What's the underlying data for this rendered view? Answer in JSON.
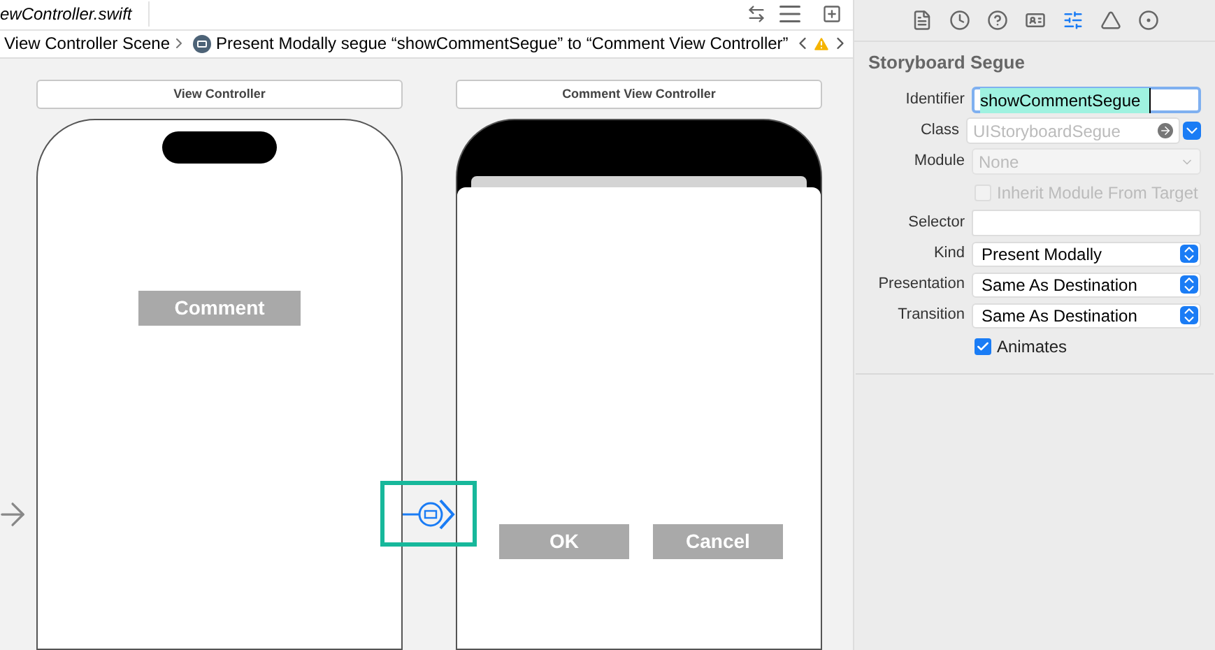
{
  "editor": {
    "file_tab": "ewController.swift",
    "breadcrumb": [
      {
        "text": "View Controller Scene",
        "kind": "scene"
      },
      {
        "text": "Present Modally segue “showCommentSegue” to “Comment View Controller”",
        "kind": "segue"
      }
    ]
  },
  "canvas": {
    "scenes": [
      {
        "title": "View Controller",
        "kind": "source",
        "buttons": [
          "Comment"
        ]
      },
      {
        "title": "Comment View Controller",
        "kind": "modal",
        "buttons": [
          "OK",
          "Cancel"
        ]
      }
    ],
    "segue": {
      "selected": true
    }
  },
  "inspector": {
    "tabs": [
      {
        "selected": false
      },
      {
        "selected": false
      },
      {
        "selected": false
      },
      {
        "selected": false
      },
      {
        "selected": true
      },
      {
        "selected": false
      },
      {
        "selected": false
      }
    ],
    "title": "Storyboard Segue",
    "rows": [
      {
        "kind": "text",
        "label": "Identifier",
        "value": "showCommentSegue",
        "focused": true
      },
      {
        "kind": "combo",
        "label": "Class",
        "placeholder": "UIStoryboardSegue"
      },
      {
        "kind": "select",
        "label": "Module",
        "placeholder": "None",
        "disabled": true
      },
      {
        "kind": "check",
        "label": "Inherit Module From Target",
        "checked": false,
        "disabled": true
      },
      {
        "kind": "text",
        "label": "Selector",
        "value": "",
        "focused": false
      },
      {
        "kind": "popup",
        "label": "Kind",
        "value": "Present Modally"
      },
      {
        "kind": "popup",
        "label": "Presentation",
        "value": "Same As Destination"
      },
      {
        "kind": "popup",
        "label": "Transition",
        "value": "Same As Destination"
      },
      {
        "kind": "check",
        "label": "Animates",
        "checked": true,
        "disabled": false
      }
    ]
  }
}
